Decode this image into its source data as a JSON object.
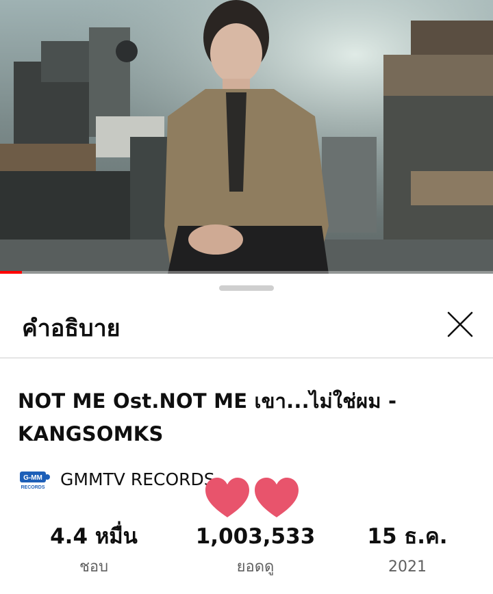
{
  "video": {
    "progress_fraction": 0.045
  },
  "sheet": {
    "title": "คำอธิบาย",
    "close_icon": "close-icon"
  },
  "details": {
    "title": "NOT ME Ost.NOT ME เขา...ไม่ใช่ผม - KANGSOMKS",
    "channel": {
      "name": "GMMTV RECORDS",
      "logo_text": "G-MM",
      "logo_subtext": "RECORDS"
    },
    "stats": {
      "likes": {
        "value": "4.4 หมื่น",
        "label": "ชอบ"
      },
      "views": {
        "value": "1,003,533",
        "label": "ยอดดู"
      },
      "date": {
        "value": "15 ธ.ค.",
        "label": "2021"
      }
    }
  },
  "colors": {
    "accent_progress": "#ff0000",
    "heart": "#e8546c"
  }
}
